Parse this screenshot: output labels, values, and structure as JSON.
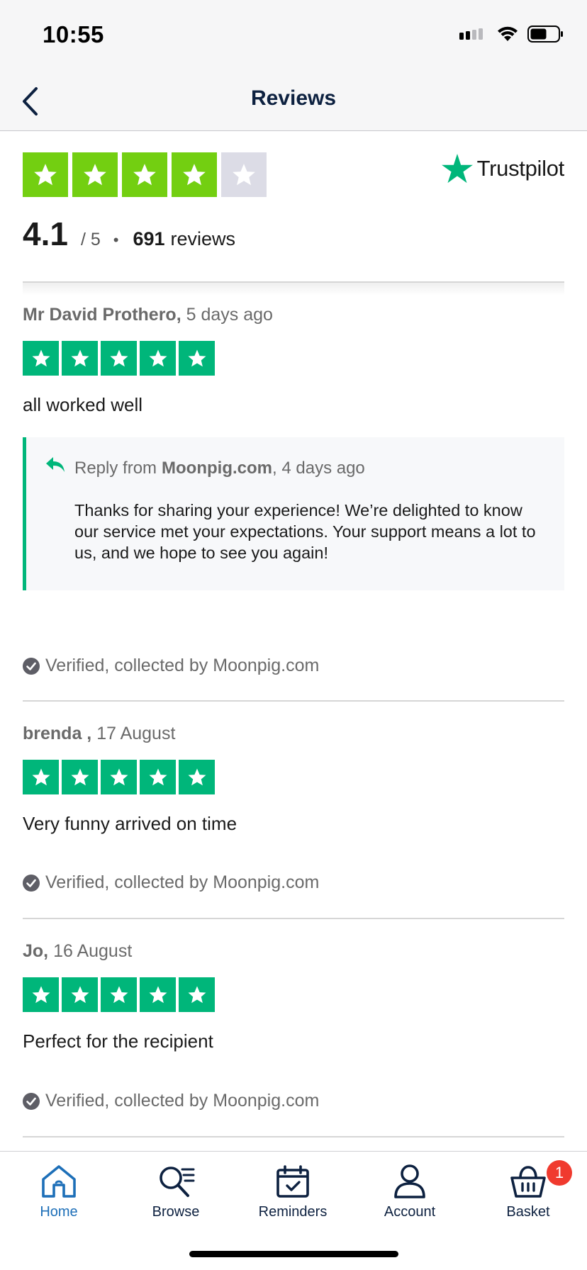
{
  "status_bar": {
    "time": "10:55"
  },
  "nav": {
    "title": "Reviews"
  },
  "summary": {
    "stars_filled": 4,
    "stars_total": 5,
    "rating": "4.1",
    "out_of": "/ 5",
    "separator": "•",
    "review_count": "691",
    "review_word": "reviews",
    "brand": "Trustpilot",
    "colors": {
      "filled_star": "#73cf11",
      "empty_star": "#dcdce6",
      "trustpilot_green": "#00b67a"
    }
  },
  "reviews": [
    {
      "name": "Mr David Prothero,",
      "date": "5 days ago",
      "stars": 5,
      "text": "all worked well",
      "reply": {
        "prefix": "Reply from",
        "from": "Moonpig.com",
        "date": ", 4 days ago",
        "body": "Thanks for sharing your experience! We’re delighted to know our service met your expectations. Your support means a lot to us, and we hope to see you again!"
      },
      "verified": "Verified, collected by Moonpig.com"
    },
    {
      "name": "brenda ,",
      "date": "17 August",
      "stars": 5,
      "text": "Very funny arrived on time",
      "verified": "Verified, collected by Moonpig.com"
    },
    {
      "name": "Jo,",
      "date": "16 August",
      "stars": 5,
      "text": "Perfect for the recipient",
      "verified": "Verified, collected by Moonpig.com"
    }
  ],
  "tabs": [
    {
      "label": "Home",
      "icon": "home-icon",
      "active": true
    },
    {
      "label": "Browse",
      "icon": "browse-search-icon",
      "active": false
    },
    {
      "label": "Reminders",
      "icon": "calendar-icon",
      "active": false
    },
    {
      "label": "Account",
      "icon": "person-icon",
      "active": false
    },
    {
      "label": "Basket",
      "icon": "basket-icon",
      "active": false,
      "badge": "1"
    }
  ]
}
